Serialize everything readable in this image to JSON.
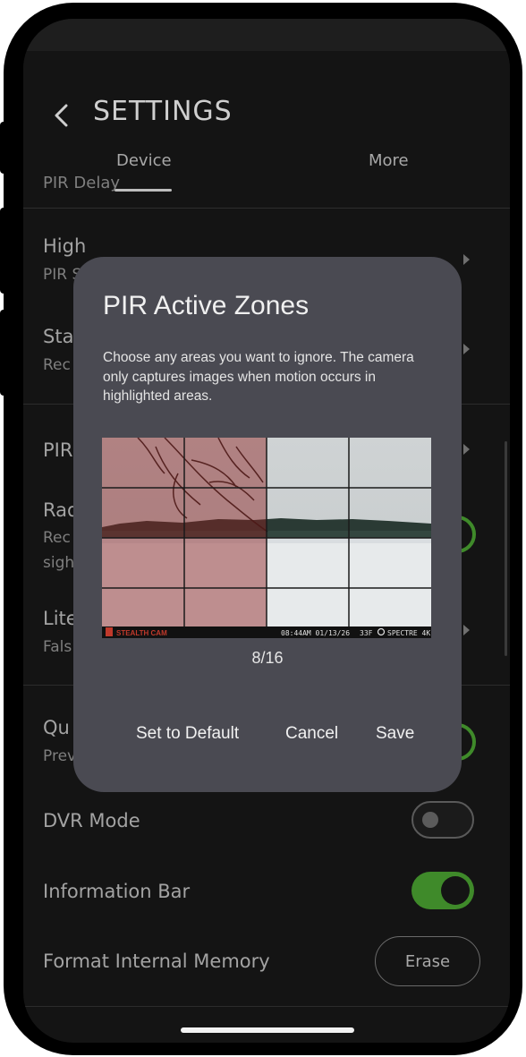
{
  "header": {
    "title": "SETTINGS",
    "tabs": [
      {
        "label": "Device",
        "selected": true
      },
      {
        "label": "More",
        "selected": false
      }
    ]
  },
  "settings": {
    "pir_delay_label": "PIR Delay",
    "high_label": "High",
    "high_sub": "PIR S",
    "sta_label": "Sta",
    "sta_sub": "Rec",
    "pir_label": "PIR",
    "rad_label": "Rad",
    "rad_sub1": "Rec",
    "rad_sub2": "sigh",
    "lite_label": "Lite",
    "lite_sub": "Fals",
    "qu_label": "Qu",
    "qu_sub": "Prev",
    "dvr_mode_label": "DVR Mode",
    "information_bar_label": "Information Bar",
    "format_memory_label": "Format Internal Memory",
    "erase_label": "Erase",
    "dvr_mode_on": false,
    "information_bar_on": true
  },
  "dialog": {
    "title": "PIR Active Zones",
    "description": "Choose any areas you want to ignore. The camera only captures images when motion occurs in highlighted areas.",
    "zone_counter": "8/16",
    "buttons": {
      "set_default": "Set to Default",
      "cancel": "Cancel",
      "save": "Save"
    },
    "camera_overlay": {
      "brand": "STEALTH CAM",
      "time_date": "08:44AM 01/13/26",
      "temperature": "33F",
      "model": "SPECTRE 4K"
    },
    "zones": [
      1,
      1,
      0,
      0,
      1,
      1,
      0,
      0,
      1,
      1,
      0,
      0,
      1,
      1,
      0,
      0
    ]
  },
  "colors": {
    "accent_green": "#3f8a2a",
    "dialog_bg": "#4a4a52",
    "zone_highlight": "#8c2020"
  }
}
